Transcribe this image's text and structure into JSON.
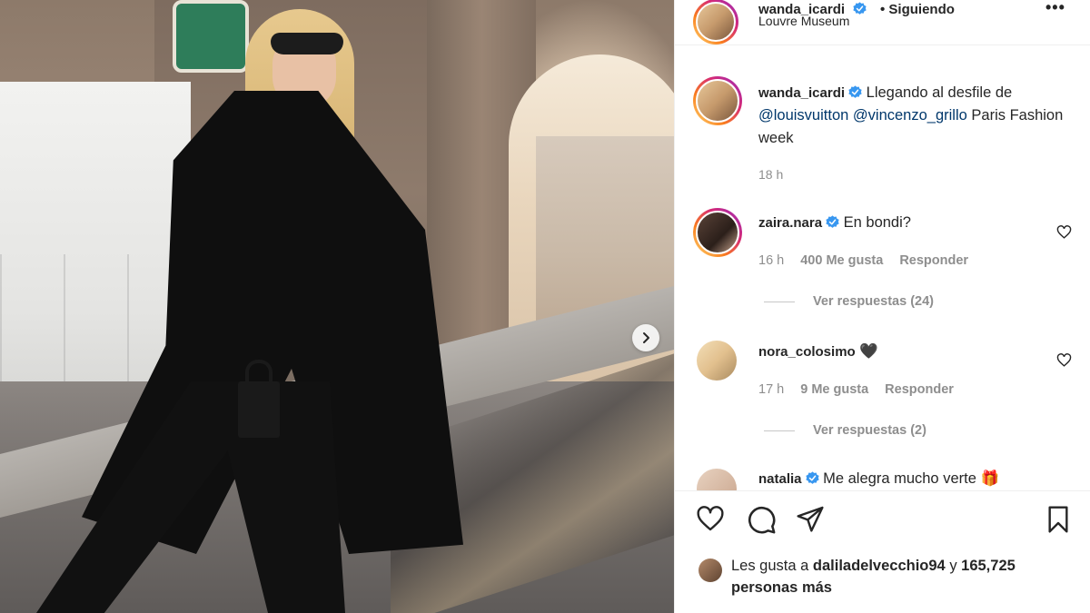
{
  "post": {
    "username": "wanda_icardi",
    "follow_status": "Siguiendo",
    "location": "Louvre Museum",
    "caption": {
      "text_before": "Llegando al desfile de ",
      "mention_1": "@louisvuitton",
      "mention_2": "@vincenzo_grillo",
      "text_after": " Paris Fashion week",
      "time": "18 h"
    }
  },
  "comments": [
    {
      "username": "zaira.nara",
      "verified": true,
      "text": "En bondi?",
      "time": "16 h",
      "likes": "400 Me gusta",
      "reply": "Responder",
      "view_replies": "Ver respuestas (24)"
    },
    {
      "username": "nora_colosimo",
      "verified": false,
      "text": "🖤",
      "time": "17 h",
      "likes": "9 Me gusta",
      "reply": "Responder",
      "view_replies": "Ver respuestas (2)"
    },
    {
      "username": "natalia",
      "verified": true,
      "text": "Me alegra mucho verte 🎁"
    }
  ],
  "likes": {
    "prefix": "Les gusta a ",
    "user": "dalila​delvecchio94",
    "middle": " y ",
    "count": "165,725 personas más"
  },
  "colors": {
    "verified_blue": "#3897f0",
    "mention_blue": "#00376b",
    "muted_gray": "#8e8e8e",
    "text": "#262626"
  },
  "icons": [
    "more-icon",
    "verified-icon",
    "heart-icon",
    "comment-icon",
    "share-icon",
    "bookmark-icon",
    "chevron-right-icon"
  ]
}
